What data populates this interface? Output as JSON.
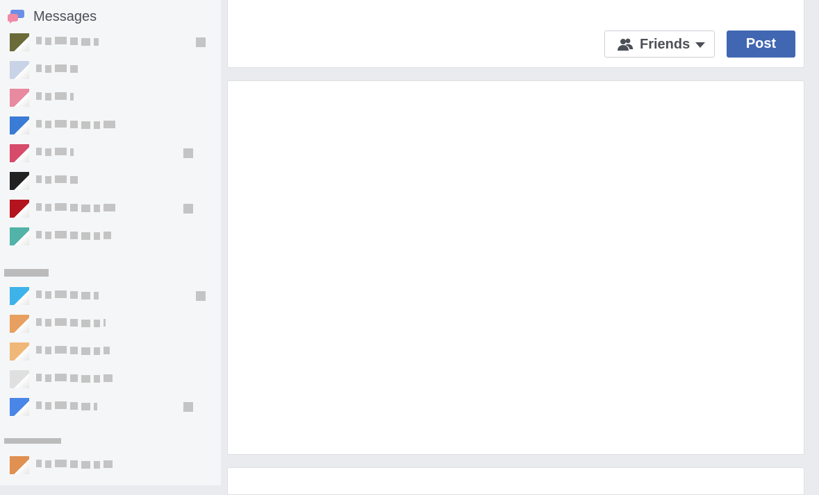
{
  "sidebar": {
    "messages_label": "Messages",
    "message_icon": "messenger-bubbles-icon",
    "conversations": [
      {
        "icon_color": "#6b6b3a",
        "label_width": 90
      },
      {
        "icon_color": "#c9d3e8",
        "label_width": 64
      },
      {
        "icon_color": "#e88aa0",
        "label_width": 54
      },
      {
        "icon_color": "#3a7bd5",
        "label_width": 118
      },
      {
        "icon_color": "#d64a6a",
        "label_width": 54
      },
      {
        "icon_color": "#222222",
        "label_width": 62
      },
      {
        "icon_color": "#b3141d",
        "label_width": 118
      },
      {
        "icon_color": "#52b3a8",
        "label_width": 108
      }
    ],
    "groups": [
      {
        "icon_color": "#3db3ea",
        "label_width": 90
      },
      {
        "icon_color": "#e8a060",
        "label_width": 100
      },
      {
        "icon_color": "#f0b878",
        "label_width": 106
      },
      {
        "icon_color": "#e0e0e0",
        "label_width": 110
      },
      {
        "icon_color": "#4a86e8",
        "label_width": 88
      }
    ],
    "more": [
      {
        "icon_color": "#e09050",
        "label_width": 110
      }
    ]
  },
  "composer": {
    "audience_label": "Friends",
    "audience_icon": "friends-icon",
    "post_label": "Post",
    "dropdown_icon": "caret-down-icon"
  }
}
